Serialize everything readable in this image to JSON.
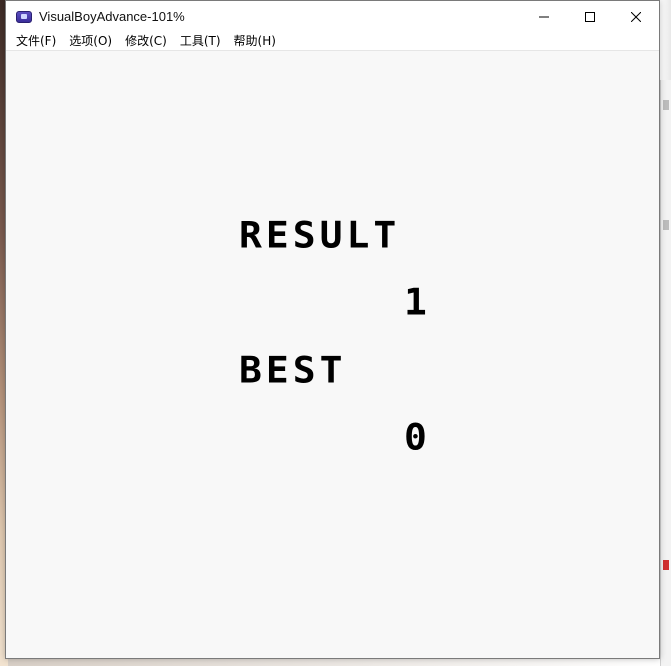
{
  "window": {
    "title": "VisualBoyAdvance-101%",
    "icons": {
      "app": "gba-app-icon",
      "minimize": "minimize-icon",
      "maximize": "maximize-icon",
      "close": "close-icon"
    }
  },
  "menu": {
    "items": [
      {
        "label": "文件(F)"
      },
      {
        "label": "选项(O)"
      },
      {
        "label": "修改(C)"
      },
      {
        "label": "工具(T)"
      },
      {
        "label": "帮助(H)"
      }
    ]
  },
  "game": {
    "result_label": "RESULT",
    "result_value": "1",
    "best_label": "BEST",
    "best_value": "0",
    "background_color": "#f8f8f8",
    "text_color": "#000000"
  }
}
